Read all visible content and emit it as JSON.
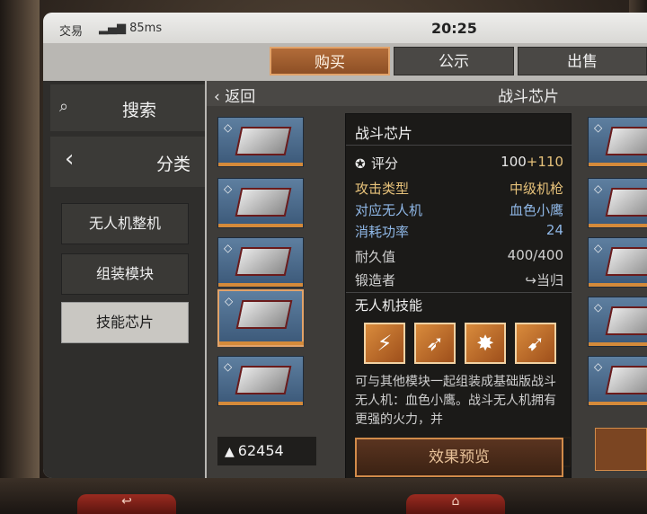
{
  "status_bar": {
    "carrier": "交易",
    "signal": "85ms",
    "time": "20:25"
  },
  "tabs": [
    {
      "label": "购买",
      "active": true
    },
    {
      "label": "公示",
      "active": false
    },
    {
      "label": "出售",
      "active": false
    }
  ],
  "sidebar": {
    "search_label": "搜索",
    "search_icon": "search-icon",
    "category_label": "分类",
    "categories": [
      {
        "label": "无人机整机",
        "selected": false
      },
      {
        "label": "组装模块",
        "selected": false
      },
      {
        "label": "技能芯片",
        "selected": true
      }
    ]
  },
  "grid": {
    "back_label": "返回",
    "title": "战斗芯片",
    "currency_value": "62454",
    "right_marks": [
      "1",
      "1",
      "1",
      "1",
      "1"
    ]
  },
  "tooltip": {
    "title": "战斗芯片",
    "score_label": "评分",
    "score_base": "100",
    "score_bonus": "+110",
    "rows": [
      {
        "key": "攻击类型",
        "value": "中级机枪",
        "key_color": "#e7c27a",
        "value_color": "#e7c27a"
      },
      {
        "key": "对应无人机",
        "value": "血色小鹰",
        "key_color": "#8fb7e6",
        "value_color": "#8fb7e6"
      },
      {
        "key": "消耗功率",
        "value": "24",
        "key_color": "#8fb7e6",
        "value_color": "#8fb7e6"
      },
      {
        "key": "耐久值",
        "value": "400/400",
        "key_color": "#d0d0d0",
        "value_color": "#d0d0d0"
      },
      {
        "key": "锻造者",
        "value": "当归",
        "key_color": "#d0d0d0",
        "value_color": "#d0d0d0"
      }
    ],
    "skill_title": "无人机技能",
    "skills": [
      "skill-lightning-icon",
      "skill-bullets-icon",
      "skill-burst-icon",
      "skill-missiles-icon"
    ],
    "description": "可与其他模块一起组装成基础版战斗无人机：血色小鹰。战斗无人机拥有更强的火力，并",
    "preview_button": "效果预览"
  },
  "colors": {
    "accent": "#d18b4a",
    "tab_active": "#b26c39"
  }
}
